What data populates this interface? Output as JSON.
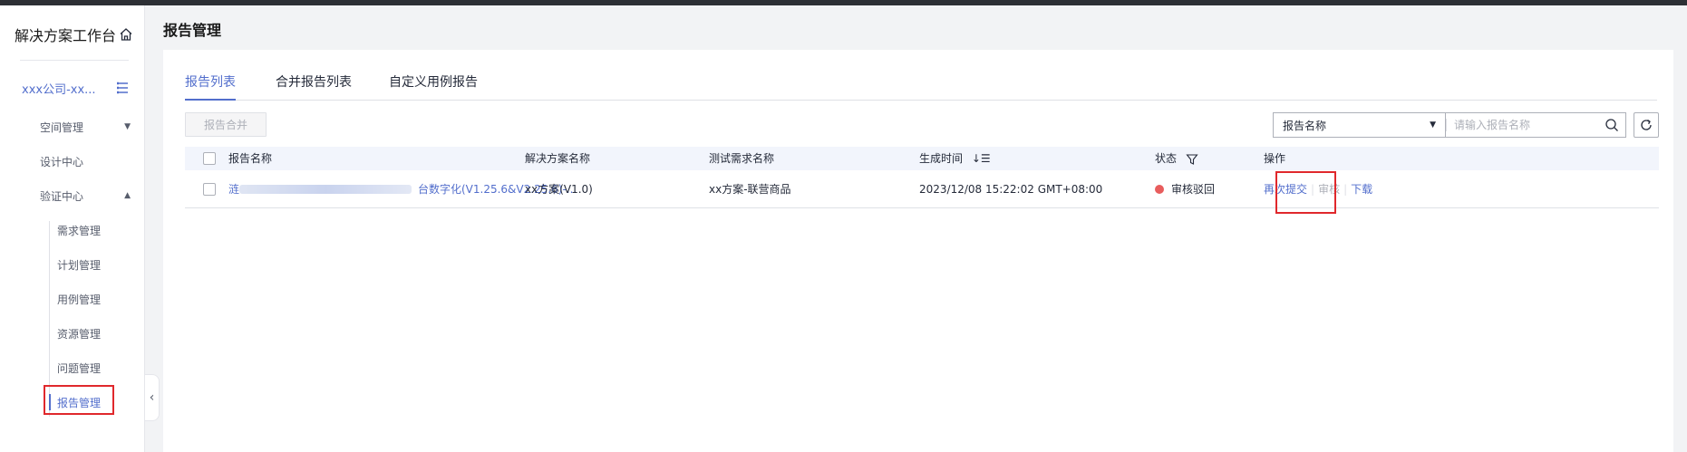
{
  "sidebar": {
    "app_title": "解决方案工作台",
    "tenant": "xxx公司-xx...",
    "menu": [
      {
        "label": "空间管理",
        "arrow": "▼"
      },
      {
        "label": "设计中心"
      },
      {
        "label": "验证中心",
        "arrow": "▲"
      }
    ],
    "submenu": [
      {
        "label": "需求管理"
      },
      {
        "label": "计划管理"
      },
      {
        "label": "用例管理"
      },
      {
        "label": "资源管理"
      },
      {
        "label": "问题管理"
      },
      {
        "label": "报告管理",
        "active": true
      }
    ],
    "collapse_glyph": "‹"
  },
  "page": {
    "title": "报告管理",
    "tabs": [
      {
        "label": "报告列表",
        "active": true
      },
      {
        "label": "合并报告列表"
      },
      {
        "label": "自定义用例报告"
      }
    ],
    "merge_button": "报告合并",
    "search": {
      "field": "报告名称",
      "placeholder": "请输入报告名称"
    }
  },
  "table": {
    "columns": [
      "报告名称",
      "解决方案名称",
      "测试需求名称",
      "生成时间",
      "状态",
      "操作"
    ],
    "sort_glyph": "↓☰",
    "rows": [
      {
        "report_name_start": "涟",
        "report_name": "台数字化(V1.25.6&V2.25.6)-...",
        "solution": "xx方案(V1.0)",
        "requirement": "xx方案-联营商品",
        "time": "2023/12/08 15:22:02 GMT+08:00",
        "status": "审核驳回",
        "actions": {
          "resubmit": "再次提交",
          "review": "审核",
          "download": "下载"
        }
      }
    ]
  },
  "colors": {
    "accent": "#526ecc",
    "status_rejected": "#e85d5d",
    "highlight": "#e0282c"
  }
}
